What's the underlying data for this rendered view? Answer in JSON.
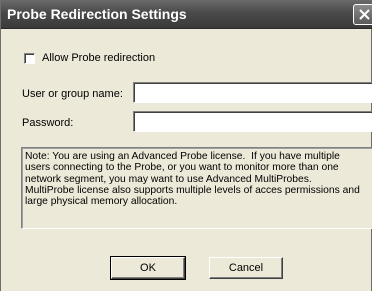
{
  "window": {
    "title": "Probe Redirection Settings"
  },
  "redirect": {
    "checkbox_label": "Allow Probe redirection",
    "checked": false
  },
  "form": {
    "user_label": "User or group name:",
    "user_value": "",
    "password_label": "Password:",
    "password_value": ""
  },
  "note": {
    "text": "Note: You are using an Advanced Probe license.  If you have multiple\nusers connecting to the Probe, or you want to monitor more than one\nnetwork segment, you may want to use Advanced MultiProbes.\nMultiProbe license also supports multiple levels of acces permissions and\nlarge physical memory allocation."
  },
  "buttons": {
    "ok": "OK",
    "cancel": "Cancel"
  },
  "icons": {
    "close": "close-icon"
  },
  "colors": {
    "titlebar": "#4a4a4a",
    "face": "#ece9d8"
  }
}
